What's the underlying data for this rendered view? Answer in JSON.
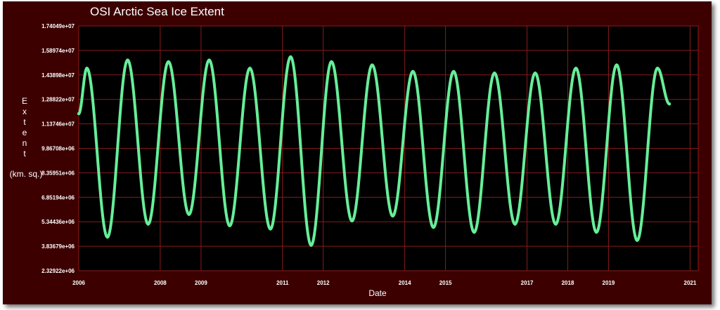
{
  "chart_data": {
    "type": "line",
    "title": "OSI Arctic Sea Ice Extent",
    "xlabel": "Date",
    "ylabel_letters": [
      "E",
      "x",
      "t",
      "e",
      "n",
      "t"
    ],
    "ylabel_unit": "(km. sq.)",
    "x_tick_labels": [
      "2006",
      "2008",
      "2009",
      "2011",
      "2012",
      "2014",
      "2015",
      "2017",
      "2018",
      "2019",
      "2021"
    ],
    "x_tick_dates": [
      "2006-01-01",
      "2008-01-01",
      "2009-01-01",
      "2011-01-01",
      "2012-01-01",
      "2014-01-01",
      "2015-01-01",
      "2017-01-01",
      "2018-01-01",
      "2019-01-01",
      "2021-01-01"
    ],
    "x_range": [
      "2006-01-01",
      "2021-03-15"
    ],
    "y_tick_labels": [
      "2.32922e+06",
      "3.83679e+06",
      "5.34436e+06",
      "6.85194e+06",
      "8.35951e+06",
      "9.86708e+06",
      "1.13746e+07",
      "1.28822e+07",
      "1.43898e+07",
      "1.58974e+07",
      "1.74049e+07"
    ],
    "ylim": [
      2329220,
      17404900
    ],
    "grid": true,
    "series": [
      {
        "color": "#66ee99",
        "points": [
          [
            "2006-01-01",
            12000000
          ],
          [
            "2006-03-15",
            14800000
          ],
          [
            "2006-09-15",
            4400000
          ],
          [
            "2007-03-15",
            15300000
          ],
          [
            "2007-09-15",
            5200000
          ],
          [
            "2008-03-15",
            15200000
          ],
          [
            "2008-09-15",
            5800000
          ],
          [
            "2009-03-15",
            15300000
          ],
          [
            "2009-09-15",
            5100000
          ],
          [
            "2010-03-15",
            14800000
          ],
          [
            "2010-09-15",
            4900000
          ],
          [
            "2011-03-15",
            15500000
          ],
          [
            "2011-09-15",
            3900000
          ],
          [
            "2012-03-15",
            15200000
          ],
          [
            "2012-09-15",
            5400000
          ],
          [
            "2013-03-15",
            15000000
          ],
          [
            "2013-09-15",
            5700000
          ],
          [
            "2014-03-15",
            14600000
          ],
          [
            "2014-09-15",
            5000000
          ],
          [
            "2015-03-15",
            14600000
          ],
          [
            "2015-09-15",
            4700000
          ],
          [
            "2016-03-15",
            14500000
          ],
          [
            "2016-09-15",
            5200000
          ],
          [
            "2017-03-15",
            14500000
          ],
          [
            "2017-09-15",
            5200000
          ],
          [
            "2018-03-15",
            14800000
          ],
          [
            "2018-09-15",
            4700000
          ],
          [
            "2019-03-15",
            15000000
          ],
          [
            "2019-09-15",
            4200000
          ],
          [
            "2020-03-15",
            14800000
          ],
          [
            "2020-06-30",
            12600000
          ]
        ]
      }
    ],
    "colors": {
      "frame": "#3d0000",
      "plot_bg": "#000000",
      "grid": "#8b1a1a",
      "line": "#66ee99",
      "text": "#ffffff"
    }
  }
}
